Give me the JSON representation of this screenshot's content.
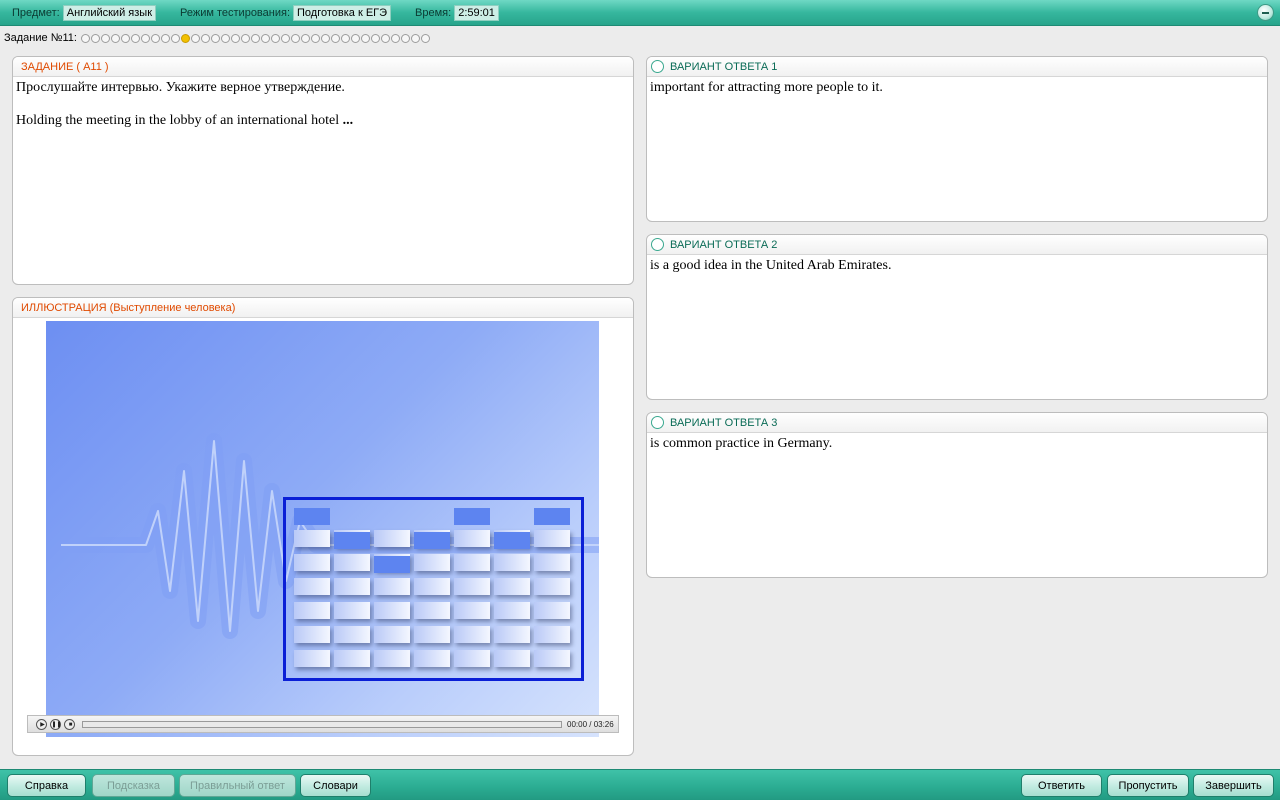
{
  "header": {
    "subject_label": "Предмет:",
    "subject_value": "Английский язык",
    "mode_label": "Режим тестирования:",
    "mode_value": "Подготовка к ЕГЭ",
    "time_label": "Время:",
    "time_value": "2:59:01"
  },
  "progress": {
    "label": "Задание №11:",
    "total": 35,
    "current": 11
  },
  "task": {
    "heading": "ЗАДАНИЕ  ( A11 )",
    "instruction": "Прослушайте интервью. Укажите верное утверждение.",
    "stem": "Holding the meeting in the lobby of an international hotel",
    "stem_suffix": "..."
  },
  "illustration": {
    "heading": "ИЛЛЮСТРАЦИЯ (Выступление человека)",
    "player_time": "00:00 / 03:26"
  },
  "answers": [
    {
      "heading": "ВАРИАНТ ОТВЕТА 1",
      "text": "important for attracting more people to it."
    },
    {
      "heading": "ВАРИАНТ ОТВЕТА 2",
      "text": "is a good idea in the United Arab Emirates."
    },
    {
      "heading": "ВАРИАНТ ОТВЕТА 3",
      "text": "is common practice in Germany."
    }
  ],
  "footer": {
    "help": "Справка",
    "hint": "Подсказка",
    "correct": "Правильный ответ",
    "dictionaries": "Словари",
    "answer": "Ответить",
    "skip": "Пропустить",
    "finish": "Завершить"
  },
  "colors": {
    "accent": "#2aab91",
    "task_heading": "#e04a00",
    "answer_heading": "#0a6b56",
    "active_dot": "#f2c100"
  },
  "icons": [
    "minimize-icon",
    "play-icon",
    "pause-icon",
    "stop-icon",
    "radio-icon"
  ]
}
